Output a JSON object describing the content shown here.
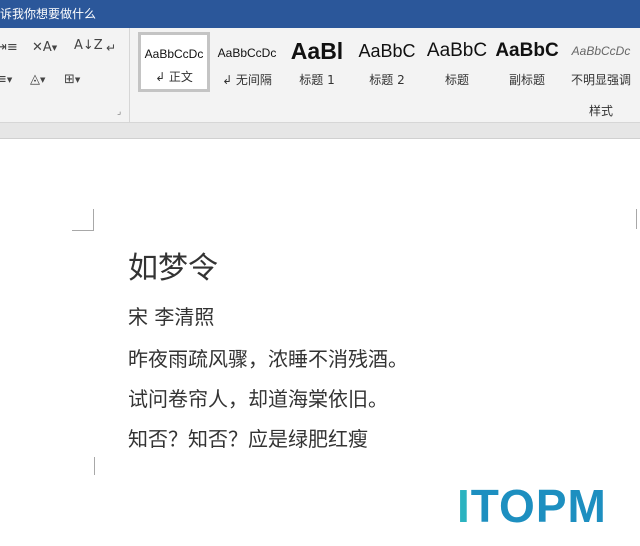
{
  "titlebar": {
    "tell_me": "诉我你想要做什么"
  },
  "toolbar": {
    "indent_icon": "indent-icon",
    "char_spacing_icon": "character-spacing-icon",
    "sort_icon": "sort-az-icon",
    "paragraph_mark_icon": "paragraph-mark-icon",
    "shading_icon": "shading-bucket-icon",
    "borders_icon": "borders-icon"
  },
  "styles_gallery": {
    "group_label": "样式",
    "items": [
      {
        "sample": "AaBbCcDc",
        "name": "↲ 正文",
        "selected": true
      },
      {
        "sample": "AaBbCcDc",
        "name": "↲ 无间隔"
      },
      {
        "sample": "AaBl",
        "name": "标题 1"
      },
      {
        "sample": "AaBbC",
        "name": "标题 2"
      },
      {
        "sample": "AaBbC",
        "name": "标题"
      },
      {
        "sample": "AaBbC",
        "name": "副标题"
      },
      {
        "sample": "AaBbCcDc",
        "name": "不明显强调"
      }
    ]
  },
  "document": {
    "title": "如梦令",
    "lines": [
      "宋  李清照",
      "昨夜雨疏风骤，浓睡不消残酒。",
      "试问卷帘人，却道海棠依旧。",
      "知否？知否？应是绿肥红瘦"
    ]
  },
  "watermark": {
    "i": "I",
    "rest": "TOPM"
  },
  "colors": {
    "titlebar": "#2b579a",
    "ribbon": "#f3f3f3",
    "watermark_teal": "#2bb3c0",
    "watermark_blue": "#1d8fc0"
  }
}
